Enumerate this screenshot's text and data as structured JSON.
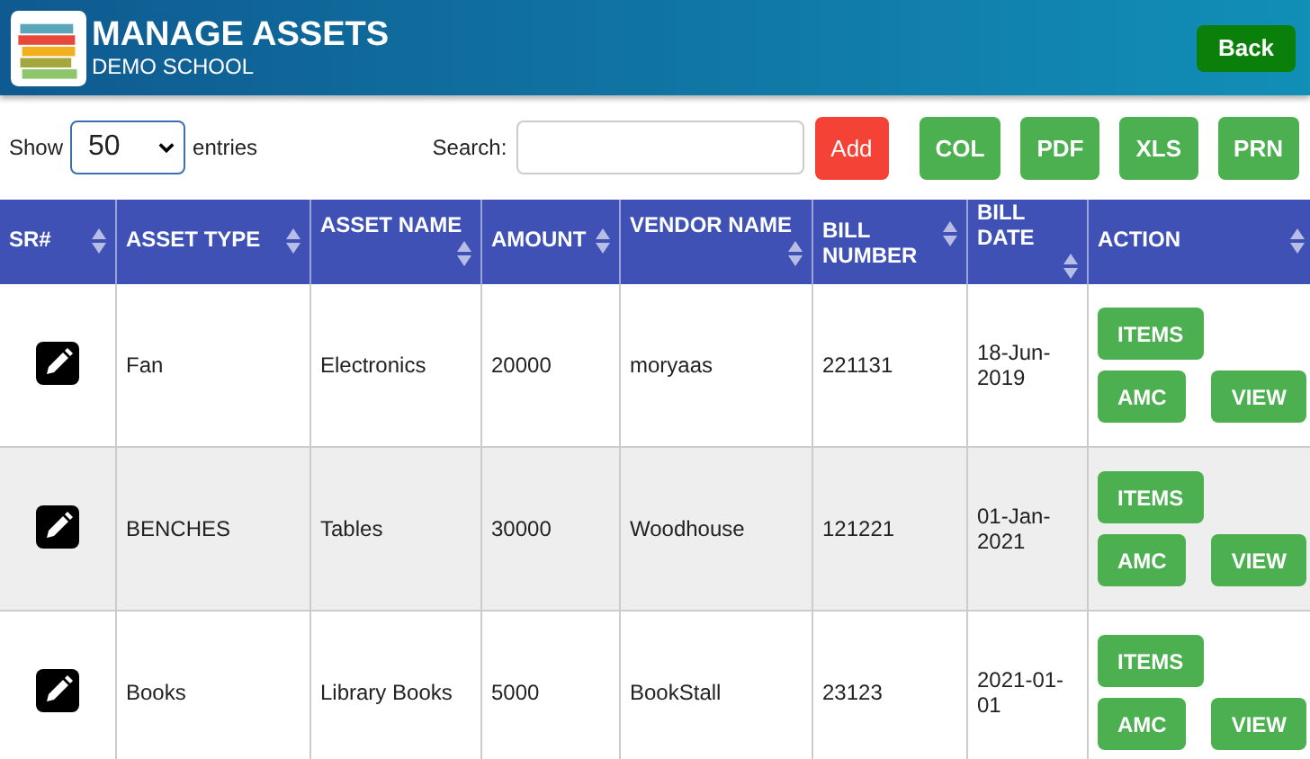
{
  "header": {
    "title": "MANAGE ASSETS",
    "subtitle": "DEMO SCHOOL",
    "back_button": "Back"
  },
  "toolbar": {
    "show_label": "Show",
    "page_size": "50",
    "entries_label": "entries",
    "search_label": "Search:",
    "buttons": [
      {
        "label": "Add",
        "kind": "danger"
      },
      {
        "label": "COL",
        "kind": "export"
      },
      {
        "label": "PDF",
        "kind": "export"
      },
      {
        "label": "XLS",
        "kind": "export"
      },
      {
        "label": "PRN",
        "kind": "export"
      }
    ]
  },
  "table": {
    "columns": [
      "SR#",
      "ASSET TYPE",
      "ASSET NAME",
      "AMOUNT",
      "VENDOR NAME",
      "BILL NUMBER",
      "BILL DATE",
      "ACTION"
    ],
    "rows": [
      {
        "asset_type": "Fan",
        "asset_name": "Electronics",
        "amount": "20000",
        "vendor_name": "moryaas",
        "bill_number": "221131",
        "bill_date": "18-Jun-2019",
        "actions": [
          "ITEMS",
          "AMC",
          "VIEW"
        ]
      },
      {
        "asset_type": "BENCHES",
        "asset_name": "Tables",
        "amount": "30000",
        "vendor_name": "Woodhouse",
        "bill_number": "121221",
        "bill_date": "01-Jan-2021",
        "actions": [
          "ITEMS",
          "AMC",
          "VIEW"
        ]
      },
      {
        "asset_type": "Books",
        "asset_name": "Library Books",
        "amount": "5000",
        "vendor_name": "BookStall",
        "bill_number": "23123",
        "bill_date": "2021-01-01",
        "actions": [
          "ITEMS",
          "AMC",
          "VIEW"
        ]
      }
    ]
  }
}
